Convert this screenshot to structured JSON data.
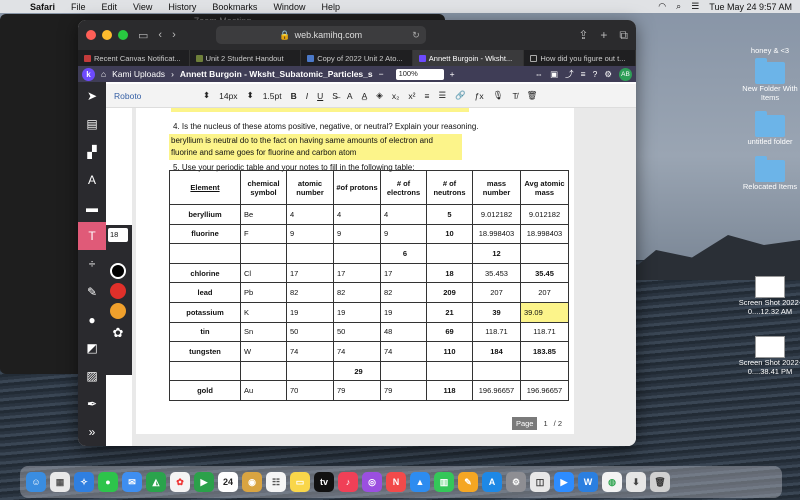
{
  "menubar": {
    "app": "Safari",
    "items": [
      "File",
      "Edit",
      "View",
      "History",
      "Bookmarks",
      "Window",
      "Help"
    ],
    "clock": "Tue May 24  9:57 AM"
  },
  "background_window": {
    "title": "Zoom Meeting"
  },
  "browser": {
    "url": "web.kamihq.com",
    "tabs": [
      {
        "label": "Recent Canvas Notificat...",
        "color": "#c23b3b"
      },
      {
        "label": "Unit 2 Student Handout",
        "color": "#6e7f3a"
      },
      {
        "label": "Copy of 2022 Unit 2 Ato...",
        "color": "#4b79c9"
      },
      {
        "label": "Annett Burgoin - Wksht...",
        "color": "#6d4aff",
        "active": true
      },
      {
        "label": "How did you figure out t...",
        "color": "#222"
      }
    ]
  },
  "kami": {
    "uploads": "Kami Uploads",
    "doc_title": "Annett Burgoin - Wksht_Subatomic_Particles_s",
    "zoom": "100%",
    "avatar": "AB",
    "font": "Roboto",
    "font_size": "14px",
    "line_width": "1.5pt",
    "text_size": "18"
  },
  "document": {
    "q4": "4.  Is the nucleus of these atoms positive, negative, or neutral?  Explain your reasoning.",
    "answer_line1": "beryllium is neutral do to the fact on having same amounts of electron and protons",
    "answer_line2": "fluorine and same goes for fluorine and carbon atom",
    "q5": "5.  Use your periodic table and your notes to fill in the following table:",
    "headers": [
      "Element",
      "chemical symbol",
      "atomic number",
      "#of protons",
      "# of electrons",
      "# of neutrons",
      "mass number",
      "Avg atomic mass"
    ],
    "rows": [
      [
        "beryllium",
        "Be",
        "4",
        "4",
        "4",
        "5",
        "9.012182",
        "9.012182"
      ],
      [
        "fluorine",
        "F",
        "9",
        "9",
        "9",
        "10",
        "18.998403",
        "18.998403"
      ],
      [
        "",
        "",
        "",
        "",
        "6",
        "",
        "12",
        ""
      ],
      [
        "chlorine",
        "Cl",
        "17",
        "17",
        "17",
        "18",
        "35.453",
        "35.45"
      ],
      [
        "lead",
        "Pb",
        "82",
        "82",
        "82",
        "209",
        "207",
        "207"
      ],
      [
        "potassium",
        "K",
        "19",
        "19",
        "19",
        "21",
        "39",
        "39.09"
      ],
      [
        "tin",
        "Sn",
        "50",
        "50",
        "48",
        "69",
        "118.71",
        "118.71"
      ],
      [
        "tungsten",
        "W",
        "74",
        "74",
        "74",
        "110",
        "184",
        "183.85"
      ],
      [
        "",
        "",
        "",
        "29",
        "",
        "",
        "",
        ""
      ],
      [
        "gold",
        "Au",
        "70",
        "79",
        "79",
        "118",
        "196.96657",
        "196.96657"
      ]
    ],
    "page_label": "Page",
    "page_current": "1",
    "page_total": "/ 2"
  },
  "desktop": {
    "icons": [
      {
        "label": "honey &   <3"
      },
      {
        "label": "New Folder With Items"
      },
      {
        "label": "untitled folder"
      },
      {
        "label": "Relocated Items"
      },
      {
        "label": "Screen Shot 2022-0....12.32 AM"
      },
      {
        "label": "Screen Shot 2022-0....38.41 PM"
      }
    ]
  },
  "colors": {
    "highlight": "#fcf48a",
    "active_tool": "#e05a78",
    "kami_purple": "#6d4aff"
  }
}
